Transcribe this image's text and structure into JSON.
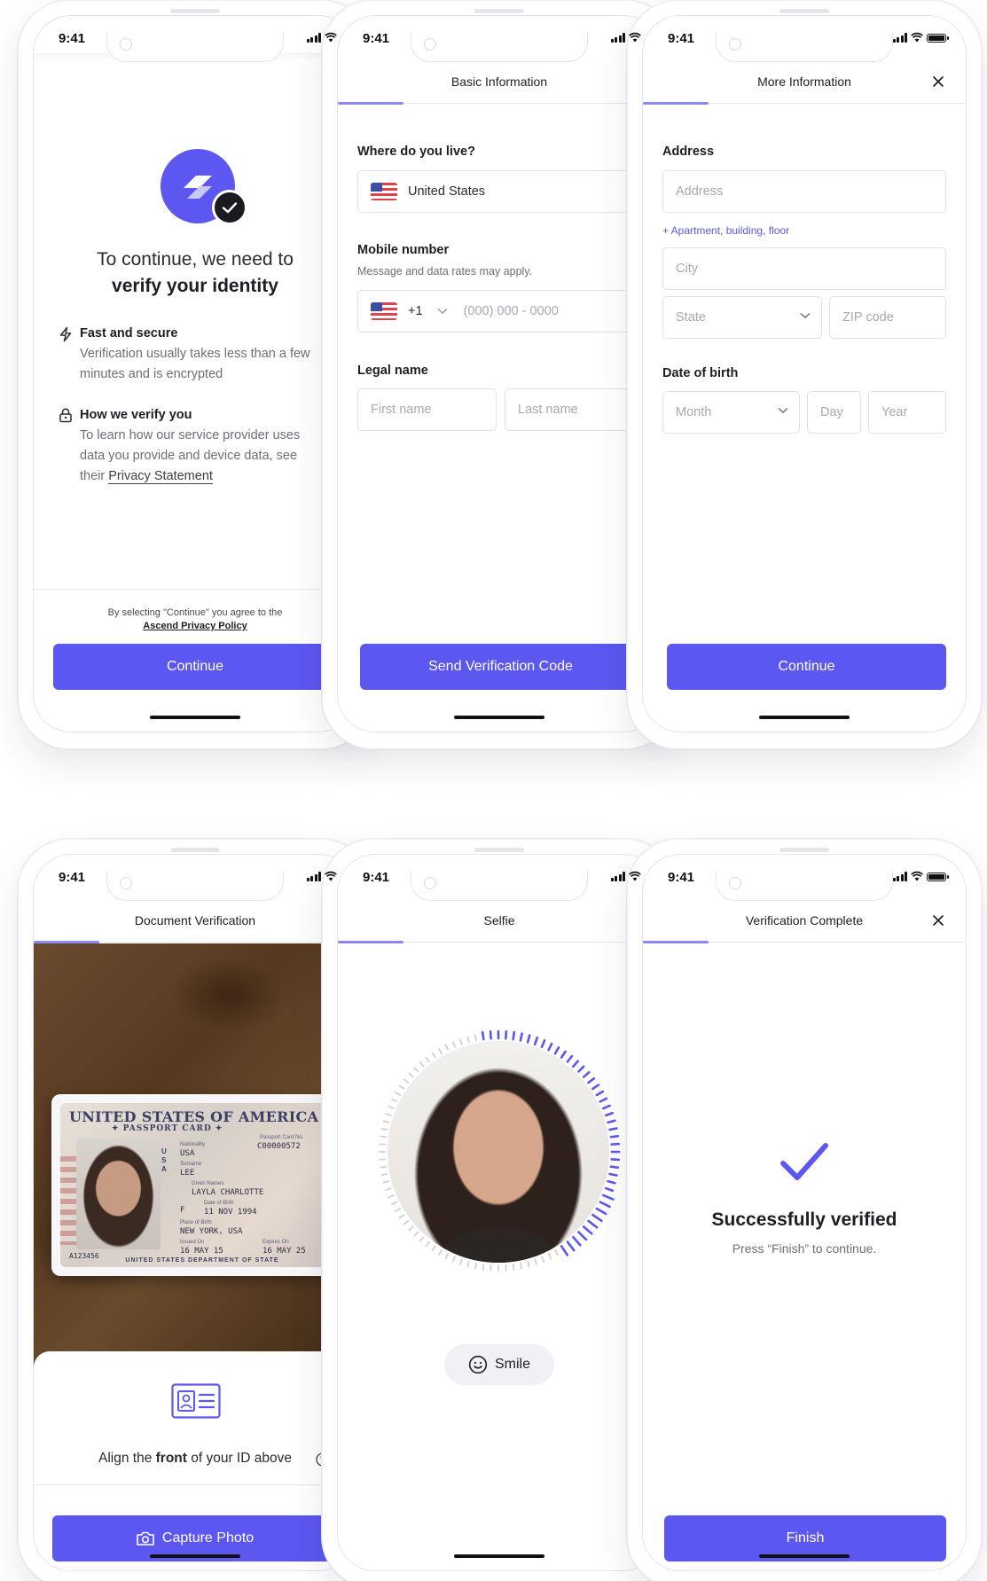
{
  "status_bar": {
    "time": "9:41"
  },
  "intro": {
    "heading_line1": "To continue, we need to",
    "heading_line2": "verify your identity",
    "features": [
      {
        "icon": "lightning-icon",
        "title": "Fast and secure",
        "body": "Verification usually takes less than a few minutes and is encrypted"
      },
      {
        "icon": "lock-icon",
        "title": "How we verify you",
        "body_prefix": "To learn how our service provider uses data you provide and device data, see their ",
        "link": "Privacy Statement"
      }
    ],
    "legal_text": "By selecting \"Continue\" you agree to the",
    "legal_link": "Ascend Privacy Policy",
    "continue_label": "Continue"
  },
  "basic_info": {
    "title": "Basic Information",
    "where_label": "Where do you live?",
    "country_value": "United States",
    "mobile_label": "Mobile number",
    "mobile_sub": "Message and data rates may apply.",
    "dial_code": "+1",
    "phone_placeholder": "(000) 000 - 0000",
    "legal_name_label": "Legal name",
    "first_name_placeholder": "First name",
    "last_name_placeholder": "Last name",
    "send_label": "Send Verification Code"
  },
  "more_info": {
    "title": "More Information",
    "address_label": "Address",
    "address_placeholder": "Address",
    "apartment_link": "+ Apartment, building, floor",
    "city_placeholder": "City",
    "state_placeholder": "State",
    "zip_placeholder": "ZIP code",
    "dob_label": "Date of birth",
    "month_placeholder": "Month",
    "day_placeholder": "Day",
    "year_placeholder": "Year",
    "continue_label": "Continue"
  },
  "document": {
    "title": "Document Verification",
    "card": {
      "title": "UNITED STATES OF AMERICA",
      "subtitle": "✦ PASSPORT CARD ✦",
      "country_vertical": "USA",
      "card_no_label": "Passport Card No.",
      "card_no": "C00000572",
      "nationality_label": "Nationality",
      "nationality": "USA",
      "surname_label": "Surname",
      "surname": "LEE",
      "given_label": "Given Names",
      "given": "LAYLA CHARLOTTE",
      "sex": "F",
      "dob_label": "Date of Birth",
      "dob": "11 NOV 1994",
      "pob_label": "Place of Birth",
      "pob": "NEW YORK, USA",
      "issued_label": "Issued On",
      "issued": "16 MAY 15",
      "expires_label": "Expires On",
      "expires": "16 MAY 25",
      "number": "A123456",
      "footer": "UNITED STATES DEPARTMENT OF STATE"
    },
    "align_prefix": "Align the ",
    "align_bold": "front",
    "align_suffix": " of your ID above",
    "capture_label": "Capture Photo"
  },
  "selfie": {
    "title": "Selfie",
    "prompt": "Smile"
  },
  "complete": {
    "title": "Verification Complete",
    "headline": "Successfully verified",
    "sub": "Press “Finish” to continue.",
    "finish_label": "Finish"
  },
  "colors": {
    "primary": "#5b57f0",
    "progress": "#8a88f5"
  }
}
